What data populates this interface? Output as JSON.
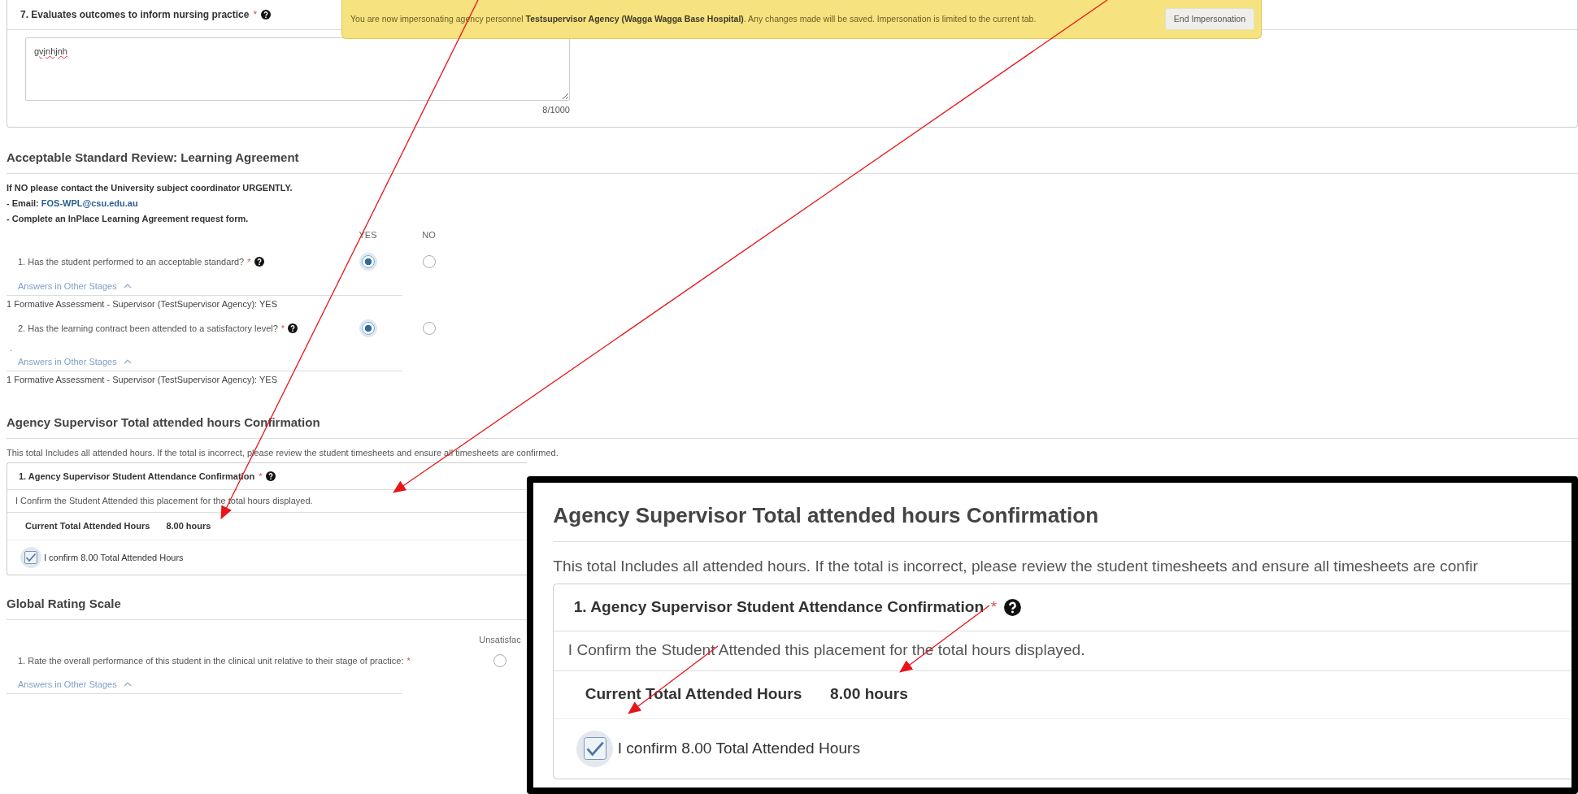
{
  "impersonation_banner": {
    "text": "You are now impersonating agency personnel **Testsupervisor Agency (Wagga Wagga Base Hospital)**. Any changes made will be saved. Impersonation is limited to the current tab.",
    "button": "End Impersonation"
  },
  "question_7": {
    "title": "7. Evaluates outcomes to inform nursing practice",
    "required_mark": "*",
    "help": true,
    "value": "gvjnhjnh",
    "counter": "8/1000"
  },
  "learning_agreement": {
    "heading": "Acceptable Standard Review: Learning Agreement",
    "instructions": [
      {
        "text": "If NO please contact the University subject coordinator URGENTLY."
      },
      {
        "text": "- Email:",
        "link": "FOS-WPL@csu.edu.au"
      },
      {
        "text": "- Complete an InPlace Learning Agreement request form."
      }
    ],
    "options": [
      "YES",
      "NO"
    ],
    "questions": [
      {
        "label": "1. Has the student performed to an acceptable standard?",
        "required_mark": "*",
        "help": true,
        "choices": [
          {
            "selected": true
          },
          {
            "selected": false
          }
        ],
        "answers_toggle": "Answers in Other Stages",
        "expanded": true,
        "other_answers": [
          "1 Formative Assessment - Supervisor (TestSupervisor Agency): YES"
        ]
      },
      {
        "label": "2. Has the learning contract been attended to a satisfactory level?",
        "required_mark": "*",
        "help": true,
        "note": ".",
        "choices": [
          {
            "selected": true
          },
          {
            "selected": false
          }
        ],
        "answers_toggle": "Answers in Other Stages",
        "expanded": true,
        "other_answers": [
          "1 Formative Assessment - Supervisor (TestSupervisor Agency): YES"
        ]
      }
    ]
  },
  "attendance": {
    "heading": "Agency Supervisor Total attended hours Confirmation",
    "intro": "This total Includes all attended hours. If the total is incorrect, please review the student timesheets and ensure all timesheets are confirmed.",
    "card": {
      "title": "1. Agency Supervisor Student Attendance Confirmation",
      "required_mark": "*",
      "help": true,
      "description": "I Confirm the Student Attended this placement for the total hours displayed.",
      "total_label": "Current Total Attended Hours",
      "total_value": "8.00 hours",
      "confirm_label": "I confirm 8.00 Total Attended Hours",
      "confirmed": true
    }
  },
  "global_rating": {
    "heading": "Global Rating Scale",
    "options": [
      "Unsatisfac"
    ],
    "questions": [
      {
        "label": "1. Rate the overall performance of this student in the clinical unit relative to their stage of practice:",
        "required_mark": "*",
        "help": false,
        "choices": [
          {
            "selected": false
          }
        ],
        "answers_toggle": "Answers in Other Stages",
        "expanded": true
      }
    ]
  },
  "zoom_inset": {
    "heading": "Agency Supervisor Total attended hours Confirmation",
    "intro": "This total Includes all attended hours. If the total is incorrect, please review the student timesheets and ensure all timesheets are confir",
    "card": {
      "title": "1. Agency Supervisor Student Attendance Confirmation",
      "required_mark": "*",
      "help": true,
      "description": "I Confirm the Student Attended this placement for the total hours displayed.",
      "total_label": "Current Total Attended Hours",
      "total_value": "8.00 hours",
      "confirm_label": "I confirm 8.00 Total Attended Hours",
      "confirmed": true
    }
  }
}
